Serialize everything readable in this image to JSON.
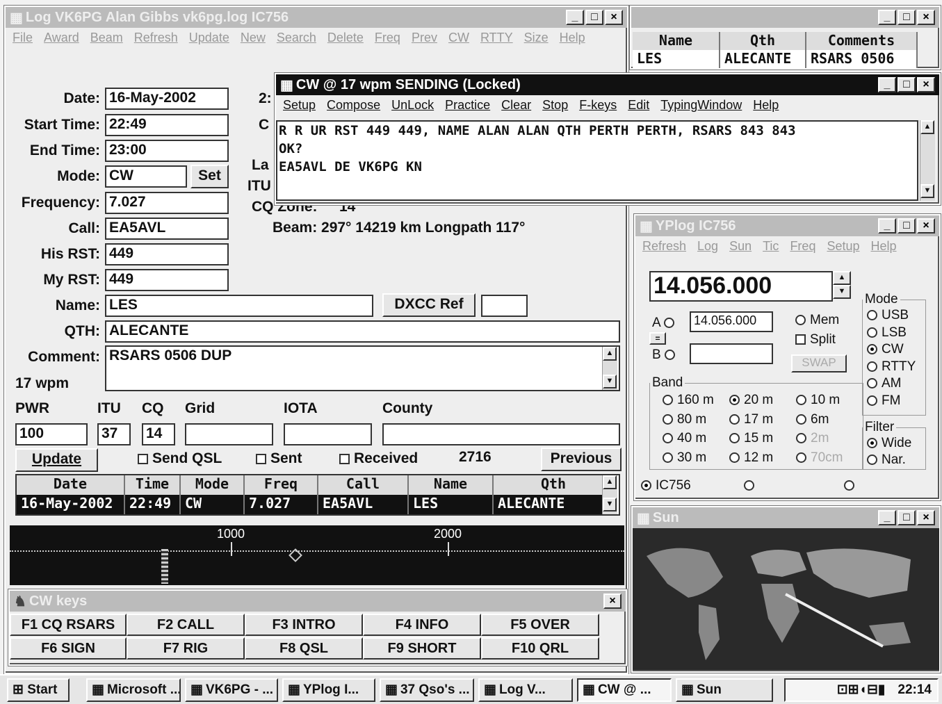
{
  "log_window": {
    "title": "Log    VK6PG  Alan Gibbs    vk6pg.log     IC756",
    "menu": [
      "File",
      "Award",
      "Beam",
      "Refresh",
      "Update",
      "New",
      "Search",
      "Delete",
      "Freq",
      "Prev",
      "CW",
      "RTTY",
      "Size",
      "Help"
    ],
    "fields": {
      "date_label": "Date:",
      "date": "16-May-2002",
      "start_label": "Start Time:",
      "start": "22:49",
      "end_label": "End Time:",
      "end": "23:00",
      "mode_label": "Mode:",
      "mode": "CW",
      "set_btn": "Set",
      "freq_label": "Frequency:",
      "freq": "7.027",
      "call_label": "Call:",
      "call": "EA5AVL",
      "hisrst_label": "His RST:",
      "hisrst": "449",
      "myrst_label": "My RST:",
      "myrst": "449",
      "name_label": "Name:",
      "name": "LES",
      "dxcc_btn": "DXCC Ref",
      "qth_label": "QTH:",
      "qth": "ALECANTE",
      "comment_label": "Comment:",
      "comment": "RSARS 0506 DUP",
      "wpm": "17 wpm"
    },
    "partial": {
      "p1": "2:",
      "p2": "C",
      "p3": "La",
      "p4": "ITU",
      "p5": "CQ Zone:",
      "p6": "14"
    },
    "beam": "Beam:   297°  14219 km   Longpath 117°",
    "lower_labels": {
      "pwr": "PWR",
      "itu": "ITU",
      "cq": "CQ",
      "grid": "Grid",
      "iota": "IOTA",
      "county": "County"
    },
    "lower_values": {
      "pwr": "100",
      "itu": "37",
      "cq": "14",
      "grid": "",
      "iota": "",
      "county": ""
    },
    "update_btn": "Update",
    "send_qsl": "Send QSL",
    "sent": "Sent",
    "received": "Received",
    "count": "2716",
    "previous_btn": "Previous",
    "grid_headers": [
      "Date",
      "Time",
      "Mode",
      "Freq",
      "Call",
      "Name",
      "Qth"
    ],
    "grid_row": [
      "16-May-2002",
      "22:49",
      "CW",
      "7.027",
      "EA5AVL",
      "LES",
      "ALECANTE"
    ],
    "scale": {
      "t1": "1000",
      "t2": "2000"
    }
  },
  "names_window": {
    "headers": [
      "Name",
      "Qth",
      "Comments"
    ],
    "row": [
      "LES",
      "ALECANTE",
      "RSARS 0506"
    ]
  },
  "cw_window": {
    "title": "CW @ 17 wpm  SENDING (Locked)",
    "menu": [
      "Setup",
      "Compose",
      "UnLock",
      "Practice",
      "Clear",
      "Stop",
      "F-keys",
      "Edit",
      "TypingWindow",
      "Help"
    ],
    "lines": [
      "R R UR RST 449 449, NAME ALAN ALAN QTH PERTH PERTH, RSARS 843 843",
      "OK?",
      "EA5AVL DE VK6PG KN"
    ]
  },
  "yplog_window": {
    "title": "YPlog    IC756",
    "menu": [
      "Refresh",
      "Log",
      "Sun",
      "Tic",
      "Freq",
      "Setup",
      "Help"
    ],
    "freq": "14.056.000",
    "a_label": "A",
    "a_value": "14.056.000",
    "b_label": "B",
    "eq": "=",
    "mem": "Mem",
    "split": "Split",
    "swap": "SWAP",
    "mode_legend": "Mode",
    "modes": [
      "USB",
      "LSB",
      "CW",
      "RTTY",
      "AM",
      "FM"
    ],
    "band_legend": "Band",
    "bands": [
      "160 m",
      "80 m",
      "40 m",
      "30 m",
      "20 m",
      "17 m",
      "15 m",
      "12 m",
      "10 m",
      "6m",
      "2m",
      "70cm"
    ],
    "filter_legend": "Filter",
    "filters": [
      "Wide",
      "Nar."
    ],
    "radio": "IC756"
  },
  "sun_window": {
    "title": "Sun"
  },
  "cwkeys_window": {
    "title": "CW keys",
    "keys": [
      "F1 CQ RSARS",
      "F2 CALL",
      "F3 INTRO",
      "F4 INFO",
      "F5 OVER",
      "F6 SIGN",
      "F7 RIG",
      "F8 QSL",
      "F9 SHORT",
      "F10 QRL"
    ]
  },
  "taskbar": {
    "start": "Start",
    "items": [
      "Microsoft ...",
      "VK6PG - ...",
      "YPlog    I...",
      "37 Qso's ...",
      "Log      V...",
      "CW @ ...",
      "Sun"
    ],
    "clock": "22:14"
  }
}
